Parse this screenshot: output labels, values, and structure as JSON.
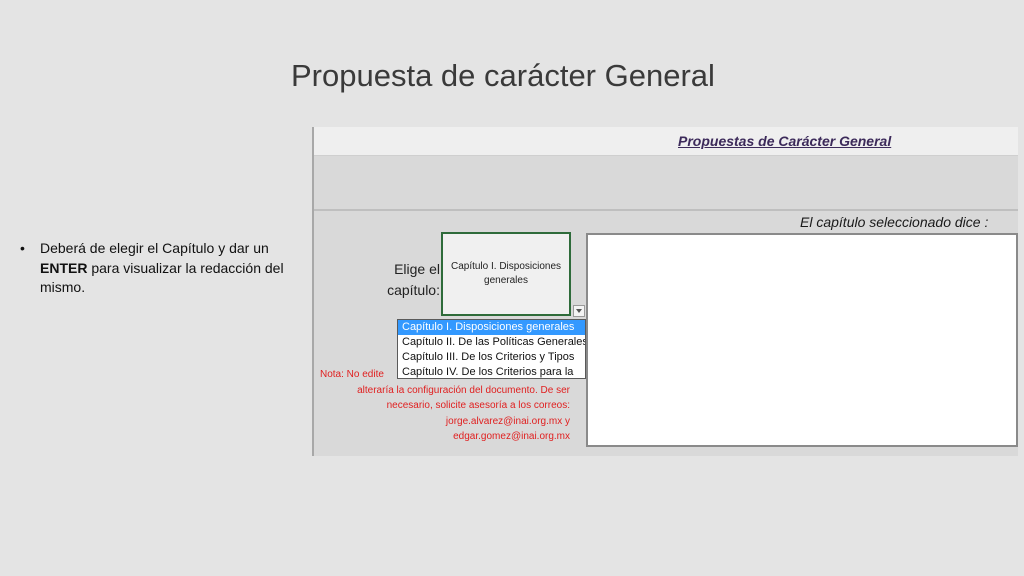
{
  "slide": {
    "title": "Propuesta de carácter General",
    "bullet": {
      "symbol": "•",
      "text_before": "Deberá de elegir el Capítulo y dar un ",
      "text_bold": "ENTER",
      "text_after": " para visualizar la redacción del mismo."
    }
  },
  "sheet": {
    "header_title": "Propuestas de Carácter General",
    "selected_caption": "El capítulo seleccionado dice :",
    "choose_label_line1": "Elige el",
    "choose_label_line2": "capítulo:",
    "current_chapter": "Capítulo I. Disposiciones generales",
    "dropdown_icon": "chevron-down-icon",
    "options": [
      "Capítulo I. Disposiciones generales",
      "Capítulo II. De las Políticas Generales",
      "Capítulo III. De los Criterios y Tipos",
      "Capítulo IV. De los Criterios para la"
    ],
    "note_lines": [
      "Nota: No edite ",
      "alteraría la configuración del documento. De ser",
      "necesario, solicite asesoría a los correos:",
      "jorge.alvarez@inai.org.mx y",
      "edgar.gomez@inai.org.mx"
    ],
    "colors": {
      "note": "#e02020",
      "selected_option": "#3399ff",
      "cell_border": "#2e6b3a"
    }
  }
}
